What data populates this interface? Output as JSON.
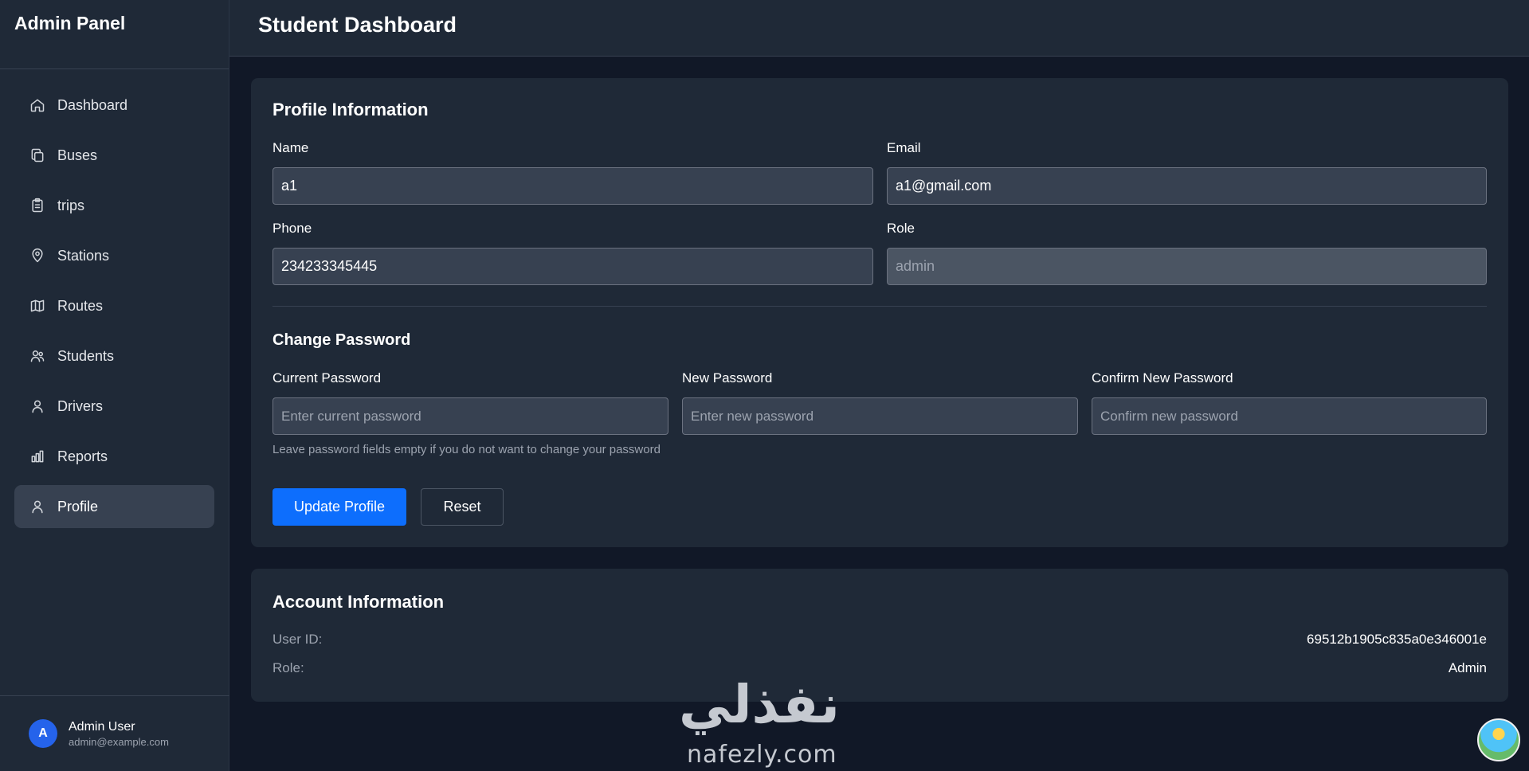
{
  "sidebar": {
    "brand": "Admin Panel",
    "items": [
      {
        "label": "Dashboard",
        "icon": "home-icon",
        "active": false
      },
      {
        "label": "Buses",
        "icon": "copy-icon",
        "active": false
      },
      {
        "label": "trips",
        "icon": "clipboard-icon",
        "active": false
      },
      {
        "label": "Stations",
        "icon": "map-pin-icon",
        "active": false
      },
      {
        "label": "Routes",
        "icon": "map-icon",
        "active": false
      },
      {
        "label": "Students",
        "icon": "users-icon",
        "active": false
      },
      {
        "label": "Drivers",
        "icon": "user-icon",
        "active": false
      },
      {
        "label": "Reports",
        "icon": "bar-chart-icon",
        "active": false
      },
      {
        "label": "Profile",
        "icon": "user-icon",
        "active": true
      }
    ],
    "user": {
      "initial": "A",
      "name": "Admin User",
      "email": "admin@example.com"
    }
  },
  "header": {
    "title": "Student Dashboard"
  },
  "profile": {
    "title": "Profile Information",
    "name_label": "Name",
    "name_value": "a1",
    "email_label": "Email",
    "email_value": "a1@gmail.com",
    "phone_label": "Phone",
    "phone_value": "234233345445",
    "role_label": "Role",
    "role_value": "admin"
  },
  "password": {
    "title": "Change Password",
    "current_label": "Current Password",
    "current_placeholder": "Enter current password",
    "new_label": "New Password",
    "new_placeholder": "Enter new password",
    "confirm_label": "Confirm New Password",
    "confirm_placeholder": "Confirm new password",
    "hint": "Leave password fields empty if you do not want to change your password"
  },
  "actions": {
    "update_label": "Update Profile",
    "reset_label": "Reset"
  },
  "account": {
    "title": "Account Information",
    "user_id_label": "User ID:",
    "user_id_value": "69512b1905c835a0e346001e",
    "role_label": "Role:",
    "role_value": "Admin"
  },
  "watermark": {
    "arabic": "نفذلي",
    "latin": "nafezly.com"
  },
  "colors": {
    "primary": "#0d6efd",
    "sidebar_bg": "#1f2937",
    "page_bg": "#111827",
    "active_item": "#374151",
    "avatar": "#2563eb"
  }
}
